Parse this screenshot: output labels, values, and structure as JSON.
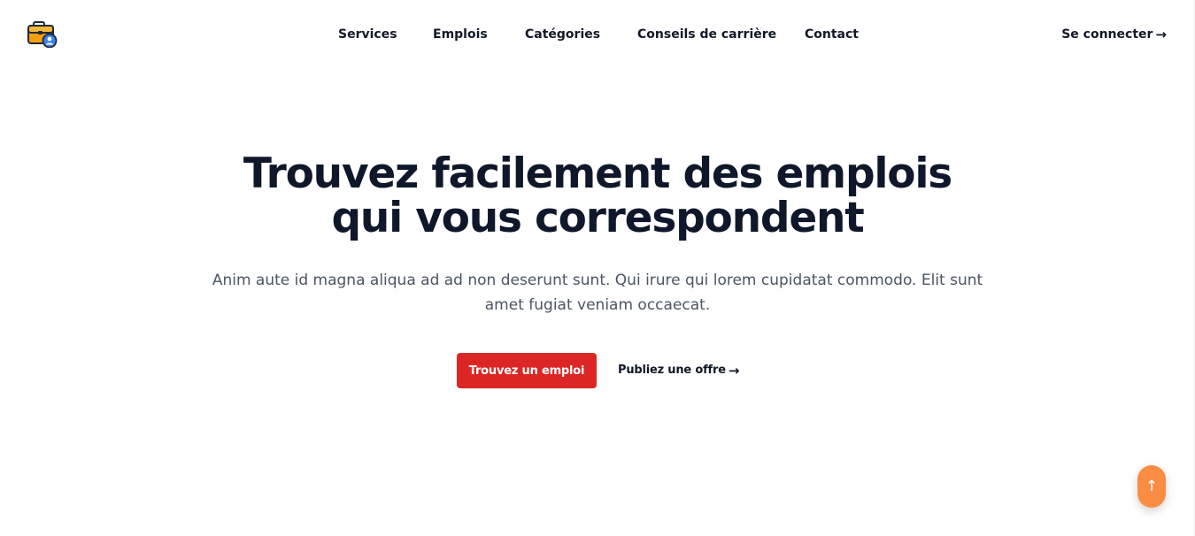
{
  "header": {
    "logo_icon": "briefcase-user-icon",
    "nav": [
      {
        "label": "Services"
      },
      {
        "label": "Emplois"
      },
      {
        "label": "Catégories"
      },
      {
        "label": "Conseils de carrière"
      },
      {
        "label": "Contact"
      }
    ],
    "signin_label": "Se connecter",
    "arrow": "→"
  },
  "hero": {
    "title_line1": "Trouvez facilement des emplois",
    "title_line2": "qui vous correspondent",
    "subtitle": "Anim aute id magna aliqua ad ad non deserunt sunt. Qui irure qui lorem cupidatat commodo. Elit sunt amet fugiat veniam occaecat.",
    "primary_button": "Trouvez un emploi",
    "secondary_link": "Publiez une offre",
    "arrow": "→"
  },
  "scroll_top": {
    "icon": "arrow-up-icon",
    "glyph": "↑"
  },
  "colors": {
    "primary": "#dc2626",
    "scroll_top": "#fb8c44",
    "text_dark": "#0f172a",
    "text_muted": "#4b5563"
  }
}
